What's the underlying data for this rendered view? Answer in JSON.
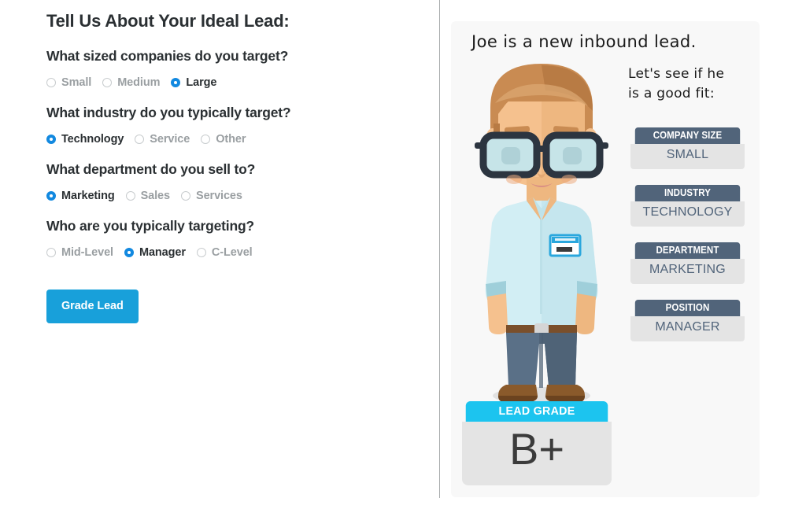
{
  "form": {
    "title": "Tell Us About Your Ideal Lead:",
    "questions": [
      {
        "label": "What sized companies do you target?",
        "options": [
          {
            "label": "Small",
            "selected": false
          },
          {
            "label": "Medium",
            "selected": false
          },
          {
            "label": "Large",
            "selected": true
          }
        ]
      },
      {
        "label": "What industry do you typically target?",
        "options": [
          {
            "label": "Technology",
            "selected": true
          },
          {
            "label": "Service",
            "selected": false
          },
          {
            "label": "Other",
            "selected": false
          }
        ]
      },
      {
        "label": "What department do you sell to?",
        "options": [
          {
            "label": "Marketing",
            "selected": true
          },
          {
            "label": "Sales",
            "selected": false
          },
          {
            "label": "Services",
            "selected": false
          }
        ]
      },
      {
        "label": "Who are you typically targeting?",
        "options": [
          {
            "label": "Mid-Level",
            "selected": false
          },
          {
            "label": "Manager",
            "selected": true
          },
          {
            "label": "C-Level",
            "selected": false
          }
        ]
      }
    ],
    "submit_label": "Grade Lead"
  },
  "result": {
    "headline": "Joe is a new inbound lead.",
    "subline_line1": "Let's see if he",
    "subline_line2": "is a good fit:",
    "attributes": [
      {
        "header": "COMPANY SIZE",
        "value": "SMALL"
      },
      {
        "header": "INDUSTRY",
        "value": "TECHNOLOGY"
      },
      {
        "header": "DEPARTMENT",
        "value": "MARKETING"
      },
      {
        "header": "POSITION",
        "value": "MANAGER"
      }
    ],
    "lead_grade": {
      "header": "LEAD GRADE",
      "value": "B+"
    },
    "character": {
      "name": "joe-character-illustration",
      "badge_label": "name badge"
    }
  },
  "colors": {
    "accent_blue": "#18a0da",
    "radio_blue": "#1289e0",
    "card_header_slate": "#51647a",
    "card_body_gray": "#e4e4e4",
    "grade_cyan": "#1cc4ef",
    "panel_bg": "#f8f8f8",
    "heading_text": "#2b3033",
    "muted_text": "#9a9fa2"
  }
}
